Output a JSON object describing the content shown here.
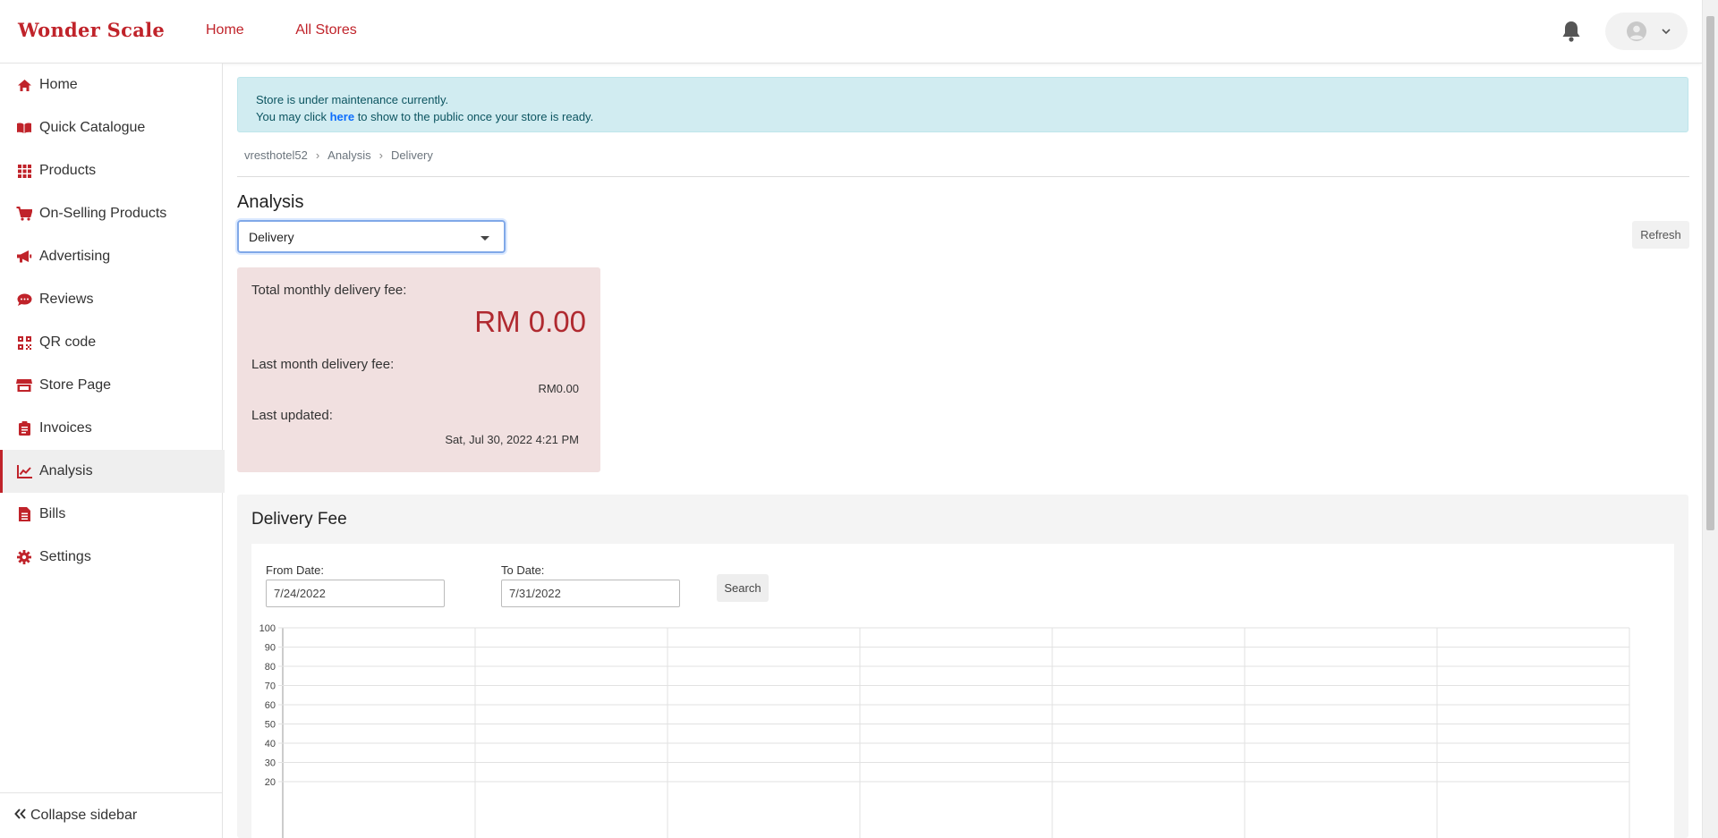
{
  "brand": {
    "logo_text": "Wonder Scale",
    "accent": "#c0232a"
  },
  "topnav": [
    {
      "label": "Home"
    },
    {
      "label": "All Stores"
    }
  ],
  "header_icons": {
    "notifications": "bell-icon",
    "user": "user-avatar-icon",
    "menu": "chevron-down-icon"
  },
  "sidebar": {
    "items": [
      {
        "label": "Home",
        "icon": "home-icon"
      },
      {
        "label": "Quick Catalogue",
        "icon": "book-icon"
      },
      {
        "label": "Products",
        "icon": "grid-icon"
      },
      {
        "label": "On-Selling Products",
        "icon": "cart-icon"
      },
      {
        "label": "Advertising",
        "icon": "megaphone-icon"
      },
      {
        "label": "Reviews",
        "icon": "comment-icon"
      },
      {
        "label": "QR code",
        "icon": "qrcode-icon"
      },
      {
        "label": "Store Page",
        "icon": "store-icon"
      },
      {
        "label": "Invoices",
        "icon": "clipboard-icon"
      },
      {
        "label": "Analysis",
        "icon": "chart-line-icon",
        "active": true
      },
      {
        "label": "Bills",
        "icon": "bill-icon"
      },
      {
        "label": "Settings",
        "icon": "gear-icon"
      }
    ],
    "collapse_label": "Collapse sidebar"
  },
  "alert": {
    "line1": "Store is under maintenance currently.",
    "line2_prefix": "You may click ",
    "link_text": "here",
    "line2_suffix": " to show to the public once your store is ready."
  },
  "breadcrumb": [
    "vresthotel52",
    "Analysis",
    "Delivery"
  ],
  "page": {
    "title": "Analysis",
    "select_value": "Delivery",
    "refresh_label": "Refresh"
  },
  "stats": {
    "total_label": "Total monthly delivery fee:",
    "total_value": "RM 0.00",
    "last_month_label": "Last month delivery fee:",
    "last_month_value": "RM0.00",
    "updated_label": "Last updated:",
    "updated_value": "Sat, Jul 30, 2022 4:21 PM"
  },
  "delivery_panel": {
    "title": "Delivery Fee",
    "from_label": "From Date:",
    "from_value": "7/24/2022",
    "to_label": "To Date:",
    "to_value": "7/31/2022",
    "search_label": "Search"
  },
  "chart_data": {
    "type": "line",
    "title": "",
    "xlabel": "",
    "ylabel": "",
    "ylim": [
      0,
      100
    ],
    "y_ticks_visible": [
      100,
      90,
      80,
      70,
      60,
      50,
      40,
      30,
      20
    ],
    "x_intervals": 7,
    "grid": true,
    "series": []
  }
}
